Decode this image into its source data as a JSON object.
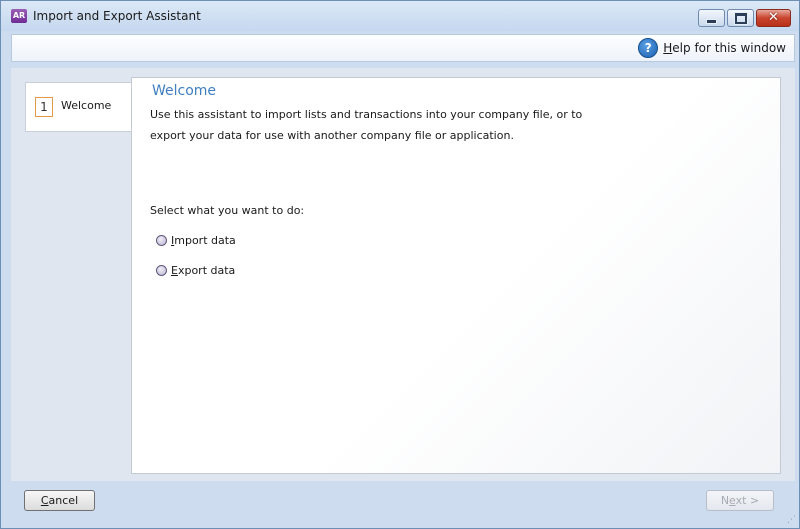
{
  "window": {
    "title": "Import and Export Assistant",
    "app_icon_text": "AR",
    "close_symbol": "✕"
  },
  "toolbar": {
    "help_icon_text": "?",
    "help_label": "Help for this window"
  },
  "steps": [
    {
      "number": "1",
      "label": "Welcome"
    }
  ],
  "content": {
    "heading": "Welcome",
    "description": "Use this assistant to import lists and transactions into your company file, or to export your data for use with another company file or application.",
    "prompt": "Select what you want to do:",
    "options": [
      {
        "label": "Import data",
        "selected": false
      },
      {
        "label": "Export data",
        "selected": false
      }
    ]
  },
  "buttons": {
    "cancel": "Cancel",
    "next": "Next >"
  }
}
